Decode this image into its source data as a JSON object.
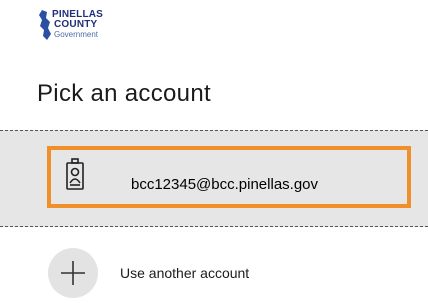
{
  "logo": {
    "line1": "PINELLAS",
    "line2": "COUNTY",
    "line3": "Government"
  },
  "title": "Pick an account",
  "account": {
    "email": "bcc12345@bcc.pinellas.gov",
    "icon": "badge-icon",
    "highlight_color": "#f0902a"
  },
  "other_account": {
    "label": "Use another account",
    "icon": "plus-icon"
  }
}
